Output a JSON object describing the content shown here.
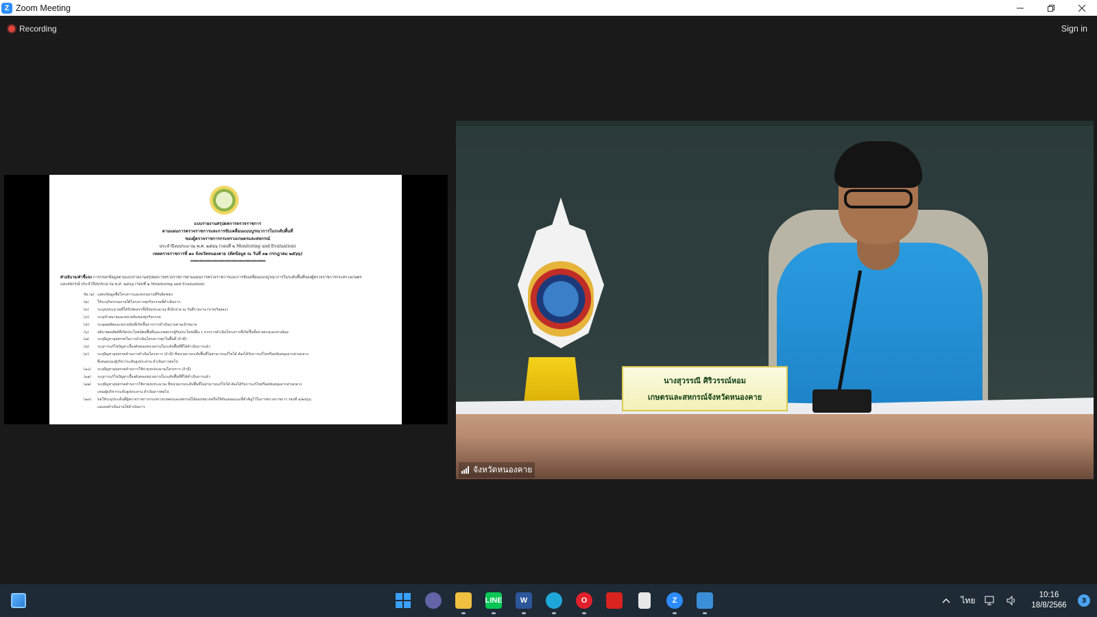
{
  "window": {
    "title": "Zoom Meeting",
    "controls": [
      "minimize",
      "restore",
      "close"
    ]
  },
  "meeting": {
    "recording_label": "Recording",
    "signin_label": "Sign in",
    "participant_label": "จังหวัดหนองคาย"
  },
  "nameplate": {
    "line1": "นางสุวรรณี ศิริวรรณ์หอม",
    "line2": "เกษตรและสหกรณ์จังหวัดหนองคาย"
  },
  "document": {
    "heading": [
      "แบบรายงานสรุปผลการตรวจราชการ",
      "ตามแผนการตรวจราชการและการขับเคลื่อนแบบบูรณาการในระดับพื้นที่",
      "ของผู้ตรวจราชการกระทรวงเกษตรและสหกรณ์",
      "ประจำปีงบประมาณ พ.ศ. ๒๕๖๖ (รอบที่ ๒ Monitoring and Evaluation)",
      "เขตตรวจราชการที่ ๑๐ จังหวัดหนองคาย (ตัดข้อมูล ณ วันที่ ๓๑ กรกฎาคม ๒๕๖๖)",
      "*************************************************"
    ],
    "instruction_label": "คำอธิบาย/คำชี้แจง",
    "instruction_text": "การกรอกข้อมูลตามแบบรายงานสรุปผลการตรวจราชการตามแผนการตรวจราชการและการขับเคลื่อนแบบบูรณาการในระดับพื้นที่ของผู้ตรวจราชการกระทรวงเกษตรและสหกรณ์ ประจำปีงบประมาณ พ.ศ. ๒๕๖๖ (รอบที่ ๒ Monitoring and Evaluation)",
    "items": [
      {
        "num": "ข้อ (๑)",
        "text": "แสดงข้อมูลชื่อโครงการและหน่วยงานที่รับผิดชอบ"
      },
      {
        "num": "(๒)",
        "text": "ให้ระบุกิจกรรมภายใต้โครงการทุกกิจกรรมที่ดำเนินการ"
      },
      {
        "num": "(๓)",
        "text": "ระบุงบประมาณที่ได้รับจัดสรรทั้งปีงบประมาณ ที่เบิกจ่าย ณ วันที่รายงาน (บาท/ร้อยละ)"
      },
      {
        "num": "(๔)",
        "text": "ระบุเป้าหมายและหน่วยนับของทุกกิจกรรม"
      },
      {
        "num": "(๕)",
        "text": "ระบุผลผลิตและหน่วยนับที่เกิดขึ้นจากการดำเนินงานตามเป้าหมาย"
      },
      {
        "num": "(๖)",
        "text": "อธิบายผลลัพธ์ที่เกิดประโยชน์ต่อพื้นที่และเกษตรกรผู้รับประโยชน์อื่น ๆ จากการดำเนินโครงการที่เกิดขึ้นทั้งทางตรงและทางอ้อม"
      },
      {
        "num": "(๗)",
        "text": "ระบุปัญหาอุปสรรคในการดำเนินโครงการทุกในพื้นที่ (ถ้ามี)"
      },
      {
        "num": "(๘)",
        "text": "ระบุการแก้ไขปัญหาเบื้องต้นของหน่วยงานในระดับพื้นที่ที่ได้ดำเนินการแล้ว"
      },
      {
        "num": "(๙)",
        "text": "ระบุปัญหาอุปสรรคด้านการดำเนินโครงการ (ถ้ามี) ที่หน่วยงานระดับพื้นที่ไม่สามารถแก้ไขได้ ต้องได้รับการแก้ไขหรือสนับสนุนจากส่วนกลาง"
      },
      {
        "num": "",
        "text": "ที่เสนอแนะผู้บริหารระดับสูงประสาน ดำเนินการต่อไป"
      },
      {
        "num": "(๑๐)",
        "text": "ระบุปัญหาอุปสรรคด้านการใช้จ่ายงบประมาณโครงการ (ถ้ามี)"
      },
      {
        "num": "(๑๑)",
        "text": "ระบุการแก้ไขปัญหาเบื้องต้นของหน่วยงานในระดับพื้นที่ที่ได้ดำเนินการแล้ว"
      },
      {
        "num": "(๑๒)",
        "text": "ระบุปัญหาอุปสรรคด้านการใช้จ่ายงบประมาณ ที่หน่วยงานระดับพื้นที่ไม่สามารถแก้ไขได้ ต้องได้รับการแก้ไขหรือสนับสนุนจากส่วนกลาง"
      },
      {
        "num": "",
        "text": "เสนอผู้บริหารระดับสูงประสาน ดำเนินการต่อไป"
      },
      {
        "num": "(๑๓)",
        "text": "ขอให้ระบุประเด็นที่ผู้ตรวจราชการกระทรวงเกษตรและสหกรณ์ได้มอบหมายหรือให้ข้อเสนอแนะที่สำคัญไว้ในการตรวจราชการ รอบที่ ๑/๒๕๖๖"
      },
      {
        "num": "",
        "text": "และผลดำเนินงานได้ดำเนินการ"
      }
    ]
  },
  "taskbar": {
    "apps": [
      {
        "name": "windows-start",
        "label": "",
        "color": "#3aa0ff",
        "running": false
      },
      {
        "name": "teams-chat",
        "label": "",
        "color": "#6264a7",
        "running": false
      },
      {
        "name": "file-explorer",
        "label": "",
        "color": "#f0c040",
        "running": true
      },
      {
        "name": "line",
        "label": "LINE",
        "color": "#06c755",
        "running": true
      },
      {
        "name": "word",
        "label": "W",
        "color": "#2b579a",
        "running": true
      },
      {
        "name": "edge",
        "label": "",
        "color": "#1fa6d8",
        "running": true
      },
      {
        "name": "opera",
        "label": "O",
        "color": "#e0202a",
        "running": true
      },
      {
        "name": "acrobat",
        "label": "",
        "color": "#d8231e",
        "running": false
      },
      {
        "name": "notepad",
        "label": "",
        "color": "#e8e8e8",
        "running": false
      },
      {
        "name": "zoom",
        "label": "Z",
        "color": "#2d8cff",
        "running": true
      },
      {
        "name": "photos",
        "label": "",
        "color": "#3a8fd8",
        "running": true
      }
    ],
    "tray": {
      "language": "ไทย",
      "time": "10:16",
      "date": "18/8/2566",
      "notification_count": "3"
    }
  }
}
